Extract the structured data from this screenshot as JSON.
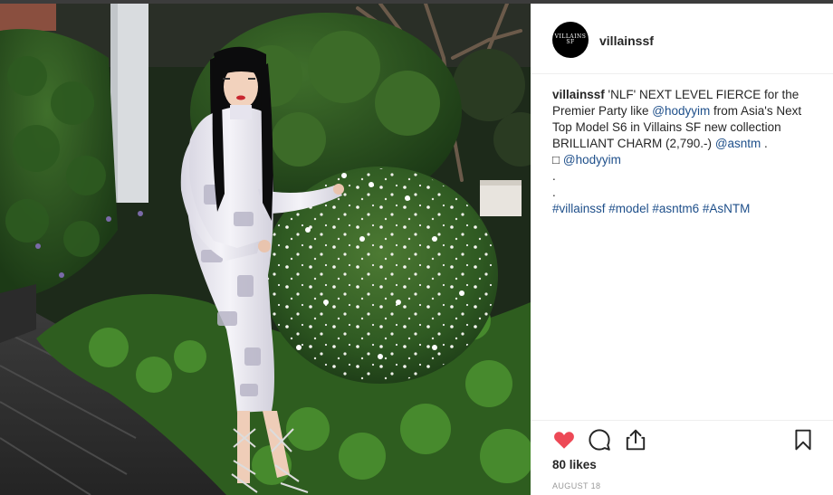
{
  "post": {
    "username": "villainssf",
    "avatar_text_line1": "VILLAINS",
    "avatar_text_line2": "SF",
    "caption": {
      "username": "villainssf",
      "text_1": " 'NLF' NEXT LEVEL FIERCE for the Premier Party like ",
      "mention_1": "@hodyyim",
      "text_2": " from Asia's Next Top Model S6 in Villains SF new collection BRILLIANT CHARM (2,790.-) ",
      "mention_2": "@asntm",
      "text_3": " .",
      "camera_glyph": "□ ",
      "mention_3": "@hodyyim",
      "dot_1": ".",
      "dot_2": ".",
      "hashtags": [
        "#villainssf",
        "#model",
        "#asntm6",
        "#AsNTM"
      ]
    },
    "likes": "80 likes",
    "date": "AUGUST 18",
    "icons": {
      "like": "heart-icon",
      "comment": "comment-icon",
      "share": "share-icon",
      "save": "bookmark-icon"
    },
    "colors": {
      "like": "#ed4956",
      "link": "#1e4f8a",
      "text": "#262626",
      "muted": "#999999"
    }
  }
}
